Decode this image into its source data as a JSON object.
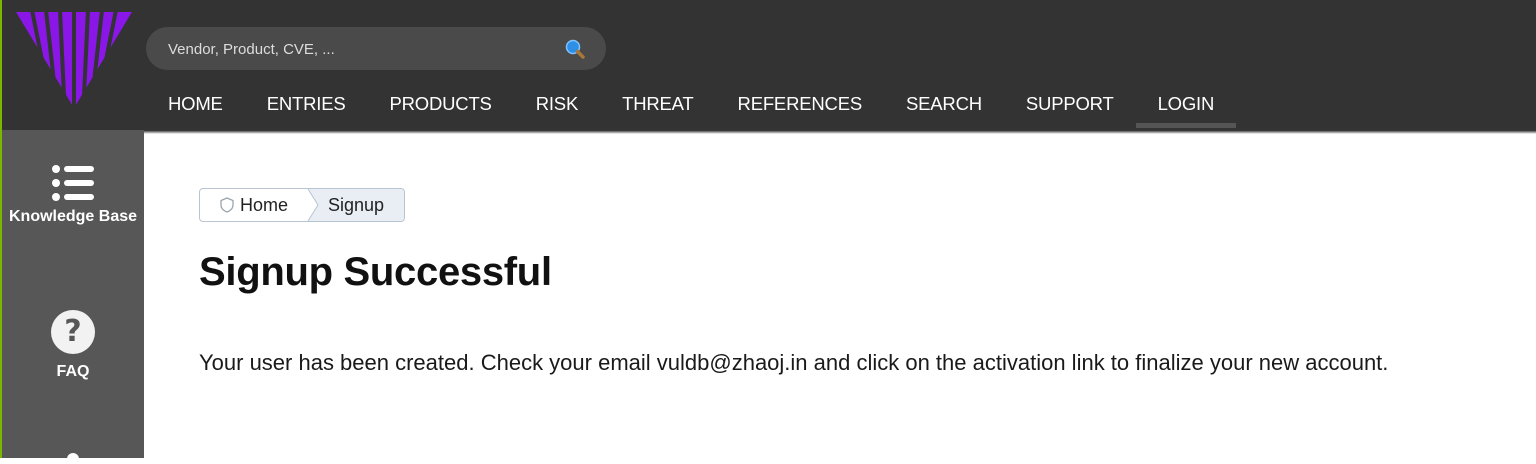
{
  "header": {
    "search": {
      "placeholder": "Vendor, Product, CVE, ...",
      "icon": "search-icon"
    },
    "nav": [
      {
        "label": "HOME"
      },
      {
        "label": "ENTRIES"
      },
      {
        "label": "PRODUCTS"
      },
      {
        "label": "RISK"
      },
      {
        "label": "THREAT"
      },
      {
        "label": "REFERENCES"
      },
      {
        "label": "SEARCH"
      },
      {
        "label": "SUPPORT"
      },
      {
        "label": "LOGIN",
        "active": true
      }
    ]
  },
  "sidebar": {
    "items": [
      {
        "label": "Knowledge Base",
        "icon": "list-icon"
      },
      {
        "label": "FAQ",
        "icon": "question-icon",
        "glyph": "?"
      }
    ]
  },
  "breadcrumb": {
    "home": "Home",
    "current": "Signup"
  },
  "main": {
    "title": "Signup Successful",
    "message": "Your user has been created. Check your email vuldb@zhaoj.in and click on the activation link to finalize your new account."
  },
  "colors": {
    "topbar": "#333333",
    "sidebar": "#575757",
    "logo": "#8a16e8",
    "accent_edge": "#7ab800"
  }
}
